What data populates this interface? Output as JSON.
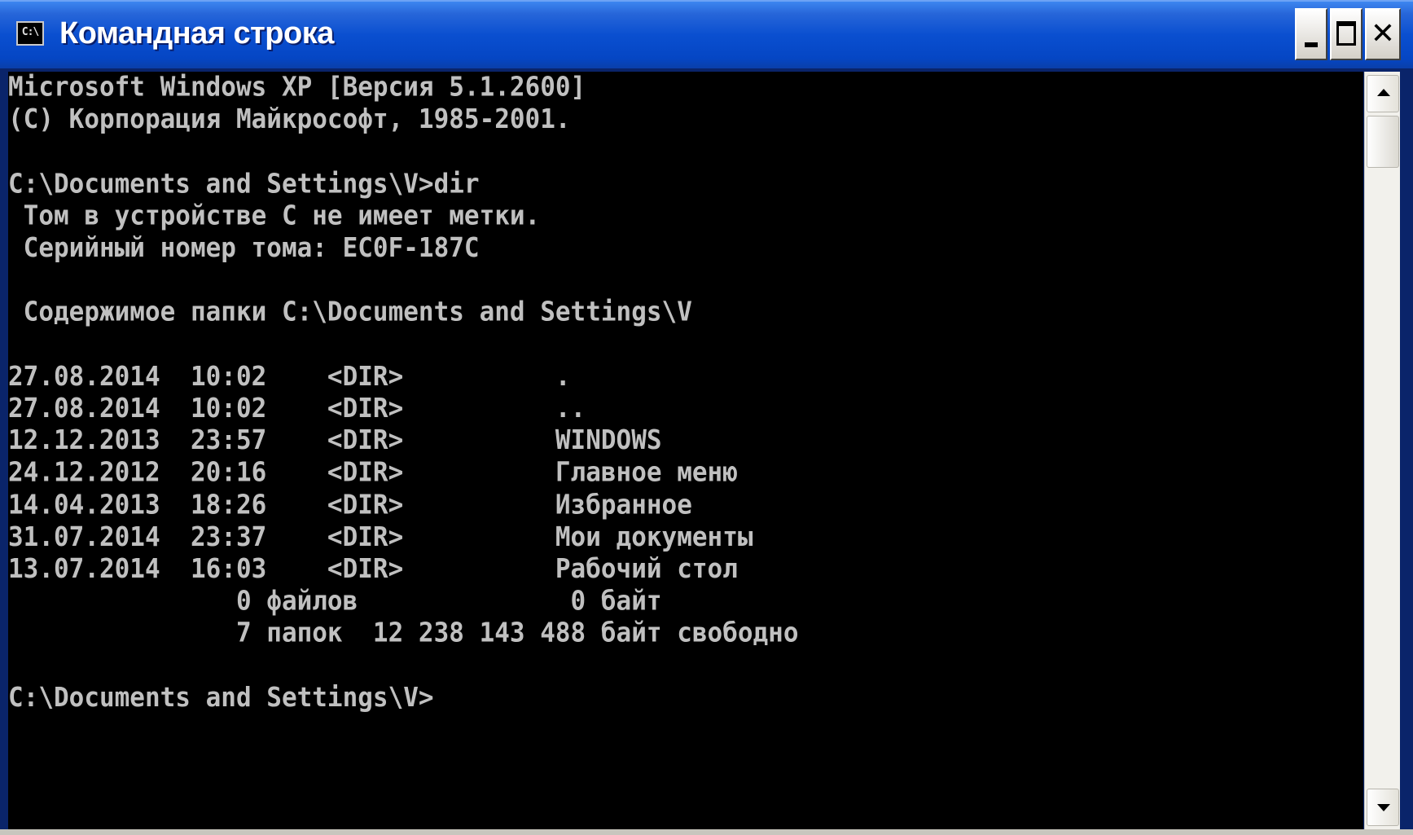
{
  "window": {
    "title": "Командная строка",
    "icon": "cmd-icon",
    "icon_label": "C:\\",
    "buttons": {
      "minimize": "minimize-icon",
      "maximize": "maximize-icon",
      "close": "close-icon"
    },
    "colors": {
      "titlebar": "#0a4fd0",
      "console_bg": "#000000",
      "console_text": "#c0c0c0"
    }
  },
  "console": {
    "lines": [
      "Microsoft Windows XP [Версия 5.1.2600]",
      "(C) Корпорация Майкрософт, 1985-2001.",
      "",
      "C:\\Documents and Settings\\V>dir",
      " Том в устройстве C не имеет метки.",
      " Серийный номер тома: EC0F-187C",
      "",
      " Содержимое папки C:\\Documents and Settings\\V",
      "",
      "27.08.2014  10:02    <DIR>          .",
      "27.08.2014  10:02    <DIR>          ..",
      "12.12.2013  23:57    <DIR>          WINDOWS",
      "24.12.2012  20:16    <DIR>          Главное меню",
      "14.04.2013  18:26    <DIR>          Избранное",
      "31.07.2014  23:37    <DIR>          Мои документы",
      "13.07.2014  16:03    <DIR>          Рабочий стол",
      "               0 файлов              0 байт",
      "               7 папок  12 238 143 488 байт свободно",
      "",
      "C:\\Documents and Settings\\V>"
    ]
  },
  "scrollbar": {
    "up": "scroll-up-arrow-icon",
    "down": "scroll-down-arrow-icon"
  }
}
